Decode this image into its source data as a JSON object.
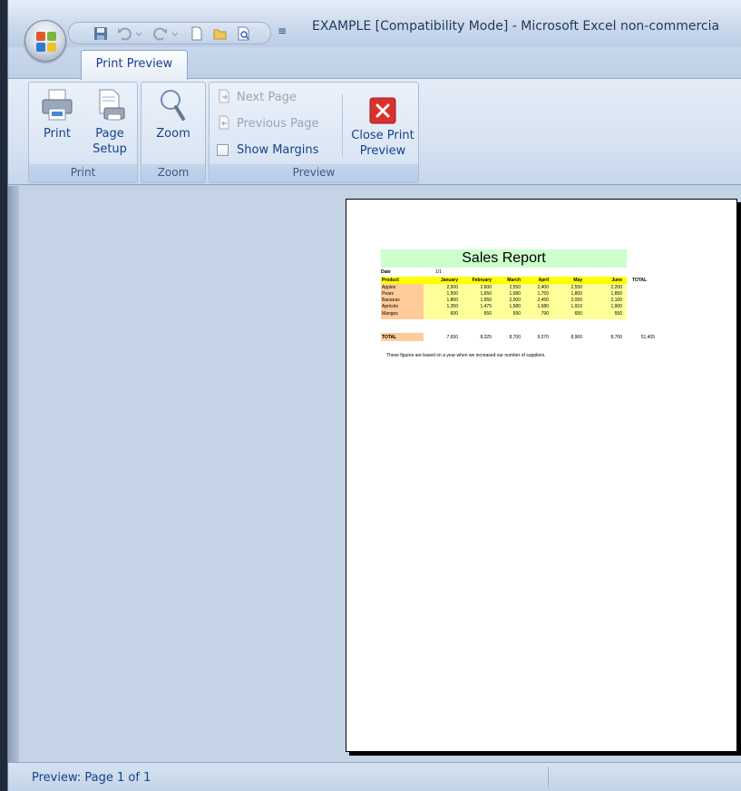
{
  "window": {
    "title": "EXAMPLE  [Compatibility Mode] - Microsoft Excel non-commercia"
  },
  "quick_access": {
    "icons": [
      "save-icon",
      "undo-icon",
      "redo-icon",
      "new-document-icon",
      "open-folder-icon",
      "print-preview-icon"
    ]
  },
  "tabs": {
    "active": "Print Preview"
  },
  "ribbon": {
    "print_group": {
      "label": "Print",
      "print_label": "Print",
      "page_setup_label_1": "Page",
      "page_setup_label_2": "Setup"
    },
    "zoom_group": {
      "label": "Zoom",
      "zoom_label": "Zoom"
    },
    "preview_group": {
      "label": "Preview",
      "next_page": "Next Page",
      "previous_page": "Previous Page",
      "show_margins": "Show Margins",
      "show_margins_checked": false,
      "close_label_1": "Close Print",
      "close_label_2": "Preview"
    }
  },
  "sheet": {
    "title": "Sales Report",
    "date_label": "Date",
    "date_value": "1/1",
    "columns": [
      "Product",
      "January",
      "February",
      "March",
      "April",
      "May",
      "June",
      "TOTAL"
    ],
    "rows": [
      {
        "product": "Apples",
        "values": [
          "2,500",
          "2,600",
          "2,550",
          "2,400",
          "2,550",
          "2,200"
        ]
      },
      {
        "product": "Pears",
        "values": [
          "1,500",
          "1,650",
          "1,680",
          "1,750",
          "1,800",
          "1,850"
        ]
      },
      {
        "product": "Bananas",
        "values": [
          "1,800",
          "1,950",
          "2,000",
          "2,450",
          "2,050",
          "2,100"
        ]
      },
      {
        "product": "Apricots",
        "values": [
          "1,350",
          "1,475",
          "1,580",
          "1,680",
          "1,910",
          "1,900"
        ]
      },
      {
        "product": "Mangos",
        "values": [
          "600",
          "650",
          "690",
          "790",
          "650",
          "550"
        ]
      }
    ],
    "total_label": "TOTAL",
    "totals": [
      "7,650",
      "8,325",
      "8,700",
      "9,070",
      "8,960",
      "8,700"
    ],
    "grand_total": "51,405",
    "note": "These figures are based on a year when we increased our number of suppliers."
  },
  "status": {
    "text": "Preview: Page 1 of 1"
  },
  "colors": {
    "title_fill": "#ccffcc",
    "header_fill": "#ffff00",
    "values_fill": "#ffff99",
    "product_fill": "#ffcc99",
    "ribbon_text": "#15428b",
    "close_button_red": "#d9322b"
  }
}
